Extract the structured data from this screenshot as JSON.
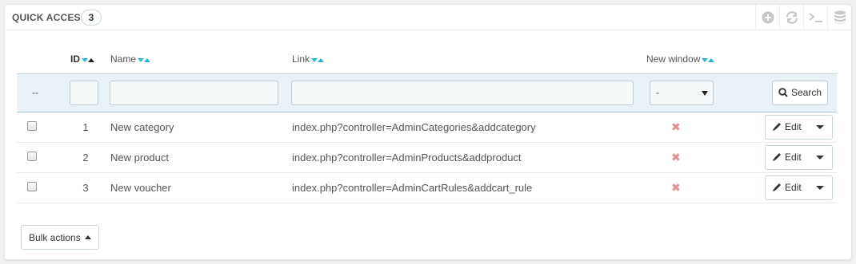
{
  "panel": {
    "title": "Quick Access",
    "count": "3",
    "toolbar_icons": [
      "add-icon",
      "refresh-icon",
      "sql-terminal-icon",
      "database-icon"
    ]
  },
  "columns": {
    "id": "ID",
    "name": "Name",
    "link": "Link",
    "new_window": "New window"
  },
  "filters": {
    "row_label": "--",
    "new_window_value": "-",
    "search_label": "Search"
  },
  "rows": [
    {
      "id": "1",
      "name": "New category",
      "link": "index.php?controller=AdminCategories&addcategory",
      "new_window": "✖",
      "edit": "Edit"
    },
    {
      "id": "2",
      "name": "New product",
      "link": "index.php?controller=AdminProducts&addproduct",
      "new_window": "✖",
      "edit": "Edit"
    },
    {
      "id": "3",
      "name": "New voucher",
      "link": "index.php?controller=AdminCartRules&addcart_rule",
      "new_window": "✖",
      "edit": "Edit"
    }
  ],
  "footer": {
    "bulk_actions": "Bulk actions"
  },
  "colors": {
    "accent": "#25b9d7",
    "filter_bg": "#e8f1f6",
    "disabled_mark": "#e08f95"
  }
}
